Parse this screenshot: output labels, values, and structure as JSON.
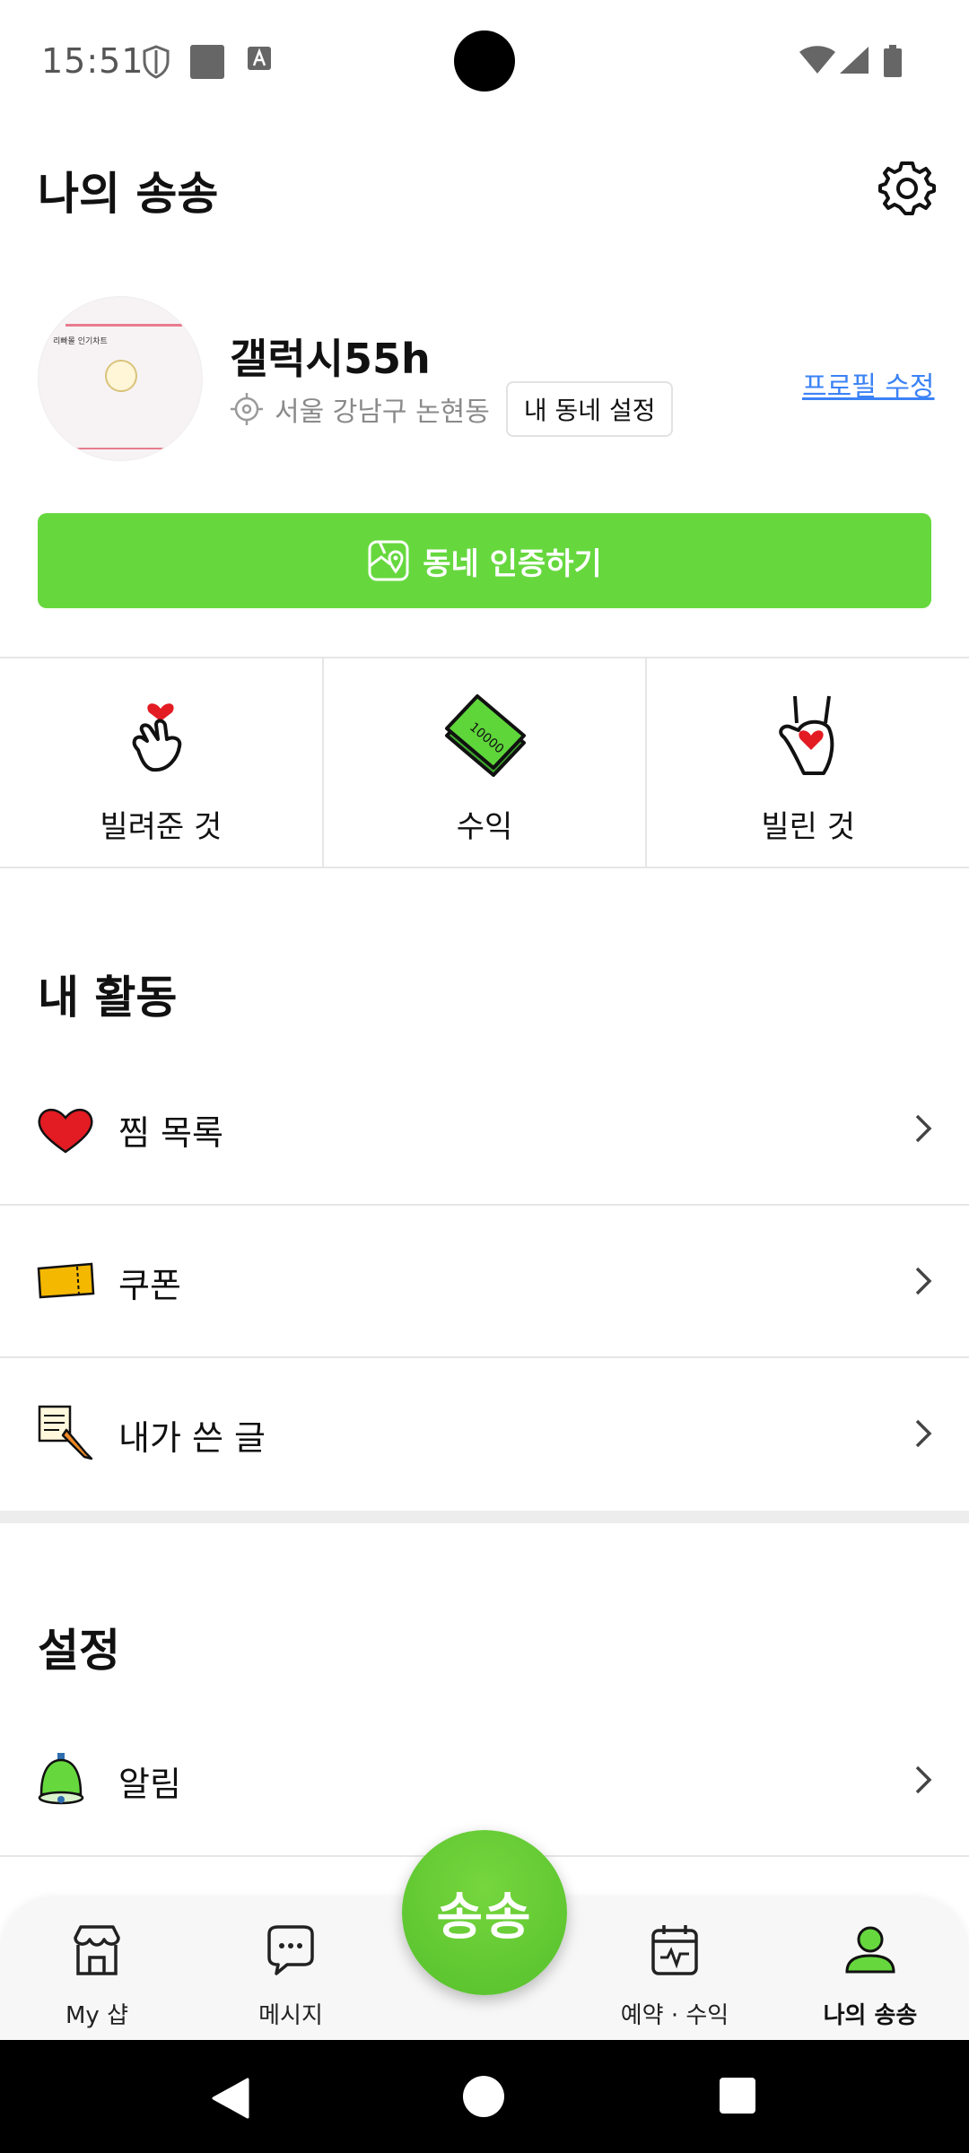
{
  "status_bar": {
    "time": "15:51"
  },
  "header": {
    "title": "나의 송송"
  },
  "profile": {
    "avatar_mini_text": "리빠몰 인기차트",
    "nickname": "갤럭시55h",
    "location": "서울 강남구 논현동",
    "set_area_label": "내 동네 설정",
    "edit_profile_label": "프로필 수정"
  },
  "verify_button": {
    "label": "동네 인증하기"
  },
  "quick_stats": [
    {
      "label": "빌려준 것",
      "icon": "heart-finger-icon"
    },
    {
      "label": "수익",
      "icon": "money-stack-icon"
    },
    {
      "label": "빌린 것",
      "icon": "heart-hand-icon"
    }
  ],
  "activity": {
    "title": "내 활동",
    "items": [
      {
        "label": "찜 목록",
        "icon": "heart-icon"
      },
      {
        "label": "쿠폰",
        "icon": "coupon-icon"
      },
      {
        "label": "내가 쓴 글",
        "icon": "pencil-note-icon"
      }
    ]
  },
  "settings": {
    "title": "설정",
    "items": [
      {
        "label": "알림",
        "icon": "bell-icon"
      }
    ]
  },
  "bottom_nav": {
    "items": [
      {
        "label": "My 샵",
        "icon": "shop-icon"
      },
      {
        "label": "메시지",
        "icon": "message-icon"
      },
      {
        "label": "예약 · 수익",
        "icon": "calendar-icon"
      },
      {
        "label": "나의 송송",
        "icon": "profile-icon",
        "active": true
      }
    ],
    "fab_label": "송송"
  },
  "colors": {
    "accent_green": "#66d83e",
    "link_blue": "#3b82f6",
    "heart_red": "#e31b23",
    "coupon_yellow": "#f5b800"
  }
}
